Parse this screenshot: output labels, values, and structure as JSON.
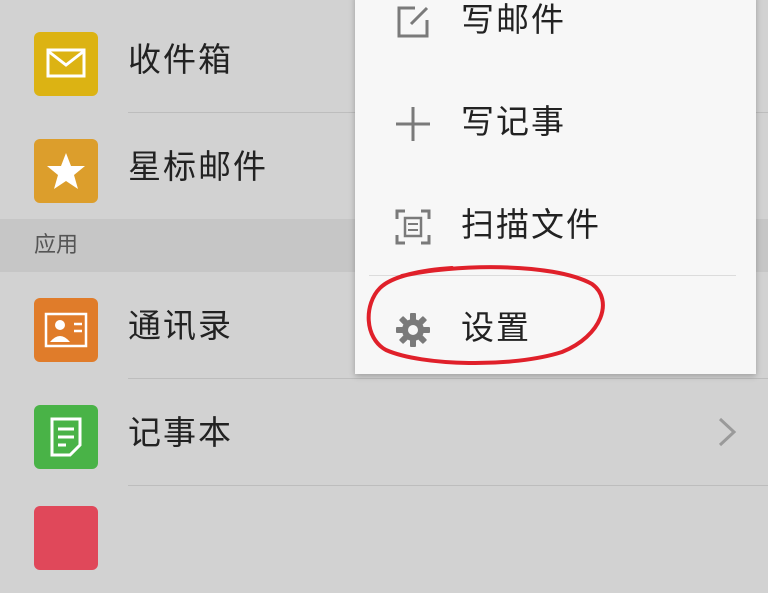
{
  "list": {
    "rows": [
      {
        "label": "收件箱",
        "icon": "mail-icon",
        "color": "#dcb313"
      },
      {
        "label": "星标邮件",
        "icon": "star-icon",
        "color": "#dc9e2c"
      }
    ],
    "section_title": "应用",
    "app_rows": [
      {
        "label": "通讯录",
        "icon": "contacts-icon",
        "color": "#e07c2a"
      },
      {
        "label": "记事本",
        "icon": "note-icon",
        "color": "#49b347"
      }
    ]
  },
  "popup_menu": {
    "items": [
      {
        "label": "写邮件",
        "icon": "compose-icon"
      },
      {
        "label": "写记事",
        "icon": "plus-icon"
      },
      {
        "label": "扫描文件",
        "icon": "scan-icon"
      },
      {
        "label": "设置",
        "icon": "gear-icon"
      }
    ]
  },
  "colors": {
    "annotation_circle": "#e0202a",
    "menu_icon": "#7a7a7a"
  }
}
